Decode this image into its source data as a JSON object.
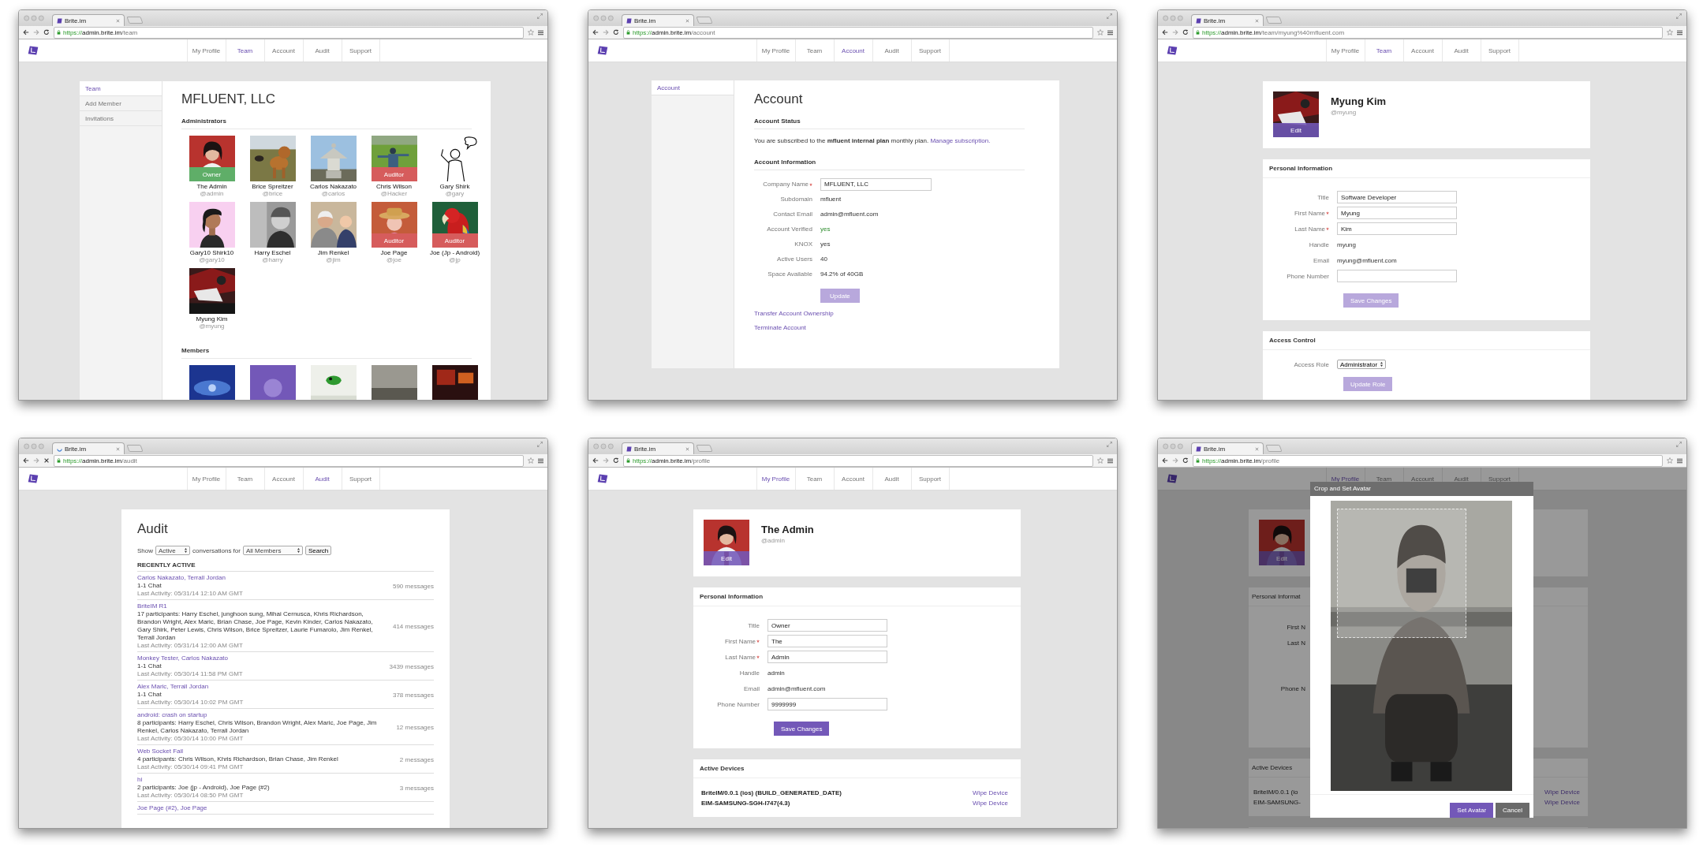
{
  "windows": [
    {
      "kind": "team",
      "tab_title": "Brite.im",
      "loading": false,
      "url": {
        "scheme": "https://",
        "host": "admin.brite.im",
        "path": "/team"
      },
      "nav": [
        {
          "label": "My Profile",
          "selected": false
        },
        {
          "label": "Team",
          "selected": true
        },
        {
          "label": "Account",
          "selected": false
        },
        {
          "label": "Audit",
          "selected": false
        },
        {
          "label": "Support",
          "selected": false
        }
      ],
      "sidebar": [
        {
          "label": "Team",
          "selected": true
        },
        {
          "label": "Add Member",
          "selected": false
        },
        {
          "label": "Invitations",
          "selected": false
        }
      ],
      "title": "MFLUENT, LLC",
      "sections": [
        {
          "heading": "Administrators",
          "members": [
            {
              "name": "The Admin",
              "handle": "@admin",
              "badge": {
                "label": "Owner",
                "kind": "owner"
              }
            },
            {
              "name": "Brice Spreitzer",
              "handle": "@brice"
            },
            {
              "name": "Carlos Nakazato",
              "handle": "@carlos"
            },
            {
              "name": "Chris Wilson",
              "handle": "@Hacker",
              "badge": {
                "label": "Auditor",
                "kind": "auditor"
              }
            },
            {
              "name": "Gary Shirk",
              "handle": "@gary"
            },
            {
              "name": "Gary10 Shirk10",
              "handle": "@gary10"
            },
            {
              "name": "Harry Eschel",
              "handle": "@harry"
            },
            {
              "name": "Jim Renkel",
              "handle": "@jim"
            },
            {
              "name": "Joe Page",
              "handle": "@joe",
              "badge": {
                "label": "Auditor",
                "kind": "auditor"
              }
            },
            {
              "name": "Joe (Jp - Android)",
              "handle": "@jp",
              "badge": {
                "label": "Auditor",
                "kind": "auditor"
              }
            },
            {
              "name": "Myung Kim",
              "handle": "@myung"
            }
          ]
        },
        {
          "heading": "Members"
        }
      ]
    },
    {
      "kind": "account",
      "tab_title": "Brite.im",
      "loading": false,
      "url": {
        "scheme": "https://",
        "host": "admin.brite.im",
        "path": "/account"
      },
      "nav": [
        {
          "label": "My Profile",
          "selected": false
        },
        {
          "label": "Team",
          "selected": false
        },
        {
          "label": "Account",
          "selected": true
        },
        {
          "label": "Audit",
          "selected": false
        },
        {
          "label": "Support",
          "selected": false
        }
      ],
      "sidebar": [
        {
          "label": "Account",
          "selected": true
        }
      ],
      "title": "Account",
      "status": {
        "heading": "Account Status",
        "text": "You are subscribed to the **mfluent internal plan** monthly plan.",
        "link": "Manage subscription."
      },
      "info": {
        "heading": "Account Information",
        "fields": [
          {
            "label": "Company Name",
            "required": true,
            "kind": "input",
            "value": "MFLUENT, LLC"
          },
          {
            "label": "Subdomain",
            "required": false,
            "kind": "text",
            "value": "mfluent"
          },
          {
            "label": "Contact Email",
            "required": false,
            "kind": "text",
            "value": "admin@mfluent.com"
          },
          {
            "label": "Account Verified",
            "required": false,
            "kind": "positive",
            "value": "yes"
          },
          {
            "label": "KNOX",
            "required": false,
            "kind": "text",
            "value": "yes"
          },
          {
            "label": "Active Users",
            "required": false,
            "kind": "text",
            "value": "40"
          },
          {
            "label": "Space Available",
            "required": false,
            "kind": "text",
            "value": "94.2% of 40GB"
          }
        ],
        "button": {
          "label": "Update",
          "disabled": true
        }
      },
      "links": [
        "Transfer Account Ownership",
        "Terminate Account"
      ]
    },
    {
      "kind": "member",
      "tab_title": "Brite.im",
      "loading": false,
      "url": {
        "scheme": "https://",
        "host": "admin.brite.im",
        "path": "/team/myung%40mfluent.com"
      },
      "nav": [
        {
          "label": "My Profile",
          "selected": false
        },
        {
          "label": "Team",
          "selected": true
        },
        {
          "label": "Account",
          "selected": false
        },
        {
          "label": "Audit",
          "selected": false
        },
        {
          "label": "Support",
          "selected": false
        }
      ],
      "profile": {
        "name": "Myung Kim",
        "handle": "@myung",
        "edit_label": "Edit"
      },
      "personal": {
        "heading": "Personal Information",
        "fields": [
          {
            "label": "Title",
            "required": false,
            "kind": "input",
            "value": "Software Developer"
          },
          {
            "label": "First Name",
            "required": true,
            "kind": "input",
            "value": "Myung"
          },
          {
            "label": "Last Name",
            "required": true,
            "kind": "input",
            "value": "Kim"
          },
          {
            "label": "Handle",
            "required": false,
            "kind": "text",
            "value": "myung"
          },
          {
            "label": "Email",
            "required": false,
            "kind": "text",
            "value": "myung@mfluent.com"
          },
          {
            "label": "Phone Number",
            "required": false,
            "kind": "input"
          }
        ],
        "button": {
          "label": "Save Changes",
          "disabled": true
        }
      },
      "access": {
        "heading": "Access Control",
        "fields": [
          {
            "label": "Access Role",
            "required": false,
            "kind": "select",
            "value": "Administrator"
          }
        ],
        "button": {
          "label": "Update Role",
          "disabled": true
        }
      }
    },
    {
      "kind": "audit",
      "tab_title": "Brite.im",
      "loading": true,
      "url": {
        "scheme": "https://",
        "host": "admin.brite.im",
        "path": "/audit"
      },
      "nav": [
        {
          "label": "My Profile",
          "selected": false
        },
        {
          "label": "Team",
          "selected": false
        },
        {
          "label": "Account",
          "selected": false
        },
        {
          "label": "Audit",
          "selected": true
        },
        {
          "label": "Support",
          "selected": false
        }
      ],
      "title": "Audit",
      "filter": {
        "show_label": "Show",
        "status": "Active",
        "for_label": "conversations for",
        "member": "All Members",
        "button": "Search"
      },
      "list_heading": "RECENTLY ACTIVE",
      "conversations": [
        {
          "title": "Carlos Nakazato, Terrall Jordan",
          "summary": "1-1 Chat",
          "last_activity": "Last Activity: 05/31/14 12:10 AM GMT",
          "count": "590 messages"
        },
        {
          "title": "BriteIM R1",
          "summary": "17 participants: Harry Eschel, junghoon sung, Mihai Cernusca, Khris Richardson, Brandon Wright, Alex Maric, Brian Chase, Joe Page, Kevin Kinder, Carlos Nakazato, Gary Shirk, Peter Lewis, Chris Wilson, Brice Spreitzer, Laurie Fumarolo, Jim Renkel, Terrall Jordan",
          "last_activity": "Last Activity: 05/31/14 12:00 AM GMT",
          "count": "414 messages"
        },
        {
          "title": "Monkey Tester, Carlos Nakazato",
          "summary": "1-1 Chat",
          "last_activity": "Last Activity: 05/30/14 11:58 PM GMT",
          "count": "3439 messages"
        },
        {
          "title": "Alex Maric, Terrall Jordan",
          "summary": "1-1 Chat",
          "last_activity": "Last Activity: 05/30/14 10:02 PM GMT",
          "count": "378 messages"
        },
        {
          "title": "android: crash on startup",
          "summary": "8 participants: Harry Eschel, Chris Wilson, Brandon Wright, Alex Maric, Joe Page, Jim Renkel, Carlos Nakazato, Terrall Jordan",
          "last_activity": "Last Activity: 05/30/14 10:00 PM GMT",
          "count": "12 messages"
        },
        {
          "title": "Web Socket Fail",
          "summary": "4 participants: Chris Wilson, Khris Richardson, Brian Chase, Jim Renkel",
          "last_activity": "Last Activity: 05/30/14 09:41 PM GMT",
          "count": "2 messages"
        },
        {
          "title": "hi",
          "summary": "2 participants: Joe (jp - Android), Joe Page (#2)",
          "last_activity": "Last Activity: 05/30/14 08:50 PM GMT",
          "count": "3 messages"
        },
        {
          "title": "Joe Page (#2), Joe Page"
        }
      ]
    },
    {
      "kind": "profile",
      "tab_title": "Brite.im",
      "loading": false,
      "url": {
        "scheme": "https://",
        "host": "admin.brite.im",
        "path": "/profile"
      },
      "nav": [
        {
          "label": "My Profile",
          "selected": true
        },
        {
          "label": "Team",
          "selected": false
        },
        {
          "label": "Account",
          "selected": false
        },
        {
          "label": "Audit",
          "selected": false
        },
        {
          "label": "Support",
          "selected": false
        }
      ],
      "profile": {
        "name": "The Admin",
        "handle": "@admin",
        "edit_label": "Edit"
      },
      "personal": {
        "heading": "Personal Information",
        "fields": [
          {
            "label": "Title",
            "required": false,
            "kind": "input",
            "value": "Owner"
          },
          {
            "label": "First Name",
            "required": true,
            "kind": "input",
            "value": "The"
          },
          {
            "label": "Last Name",
            "required": true,
            "kind": "input",
            "value": "Admin"
          },
          {
            "label": "Handle",
            "required": false,
            "kind": "text",
            "value": "admin"
          },
          {
            "label": "Email",
            "required": false,
            "kind": "text",
            "value": "admin@mfluent.com"
          },
          {
            "label": "Phone Number",
            "required": false,
            "kind": "input",
            "value": "9999999"
          }
        ],
        "button": {
          "label": "Save Changes",
          "disabled": false
        }
      },
      "devices": {
        "heading": "Active Devices",
        "items": [
          {
            "name": "BriteIM/0.0.1 (ios) (BUILD_GENERATED_DATE)",
            "action": "Wipe Device"
          },
          {
            "name": "EIM-SAMSUNG-SGH-I747(4.3)",
            "action": "Wipe Device"
          }
        ]
      }
    },
    {
      "kind": "profile_modal",
      "tab_title": "Brite.im",
      "loading": false,
      "url": {
        "scheme": "https://",
        "host": "admin.brite.im",
        "path": "/profile"
      },
      "nav": [
        {
          "label": "My Profile",
          "selected": true
        },
        {
          "label": "Team",
          "selected": false
        },
        {
          "label": "Account",
          "selected": false
        },
        {
          "label": "Audit",
          "selected": false
        },
        {
          "label": "Support",
          "selected": false
        }
      ],
      "profile": {
        "edit_label": "Edit"
      },
      "personal": {
        "heading": "Personal Informat",
        "labels": [
          "First N",
          "Last N",
          "Phone N"
        ]
      },
      "devices": {
        "heading": "Active Devices",
        "items": [
          {
            "name": "BriteIM/0.0.1 (io",
            "action": "Wipe Device"
          },
          {
            "name": "EIM-SAMSUNG-",
            "action": "Wipe Device"
          }
        ]
      },
      "modal": {
        "title": "Crop and Set Avatar",
        "buttons": [
          {
            "label": "Set Avatar",
            "kind": "primary"
          },
          {
            "label": "Cancel",
            "kind": "secondary"
          }
        ]
      }
    }
  ]
}
